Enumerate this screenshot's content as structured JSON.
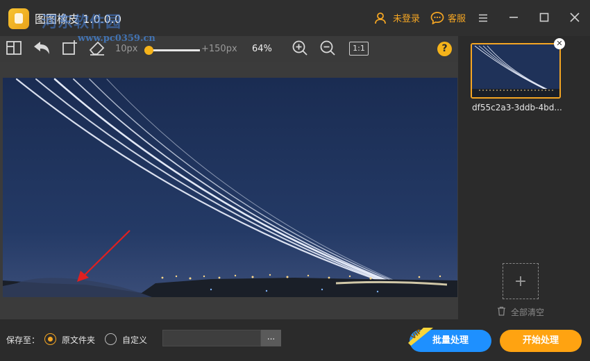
{
  "app": {
    "title": "图图橡皮 1.0.0.0",
    "watermark": "河东软件园",
    "watermark_url": "www.pc0359.cn"
  },
  "titlebar": {
    "login_label": "未登录",
    "service_label": "客服"
  },
  "toolbar": {
    "brush_min": "10px",
    "brush_max": "+150px",
    "brush_level": 0.05,
    "zoom": "64%",
    "ratio_label": "1:1",
    "help_label": "?"
  },
  "files": [
    {
      "name": "df55c2a3-3ddb-4bd..."
    }
  ],
  "side": {
    "add_label": "+",
    "clear_all": "全部清空"
  },
  "bottom": {
    "save_to": "保存至：",
    "option_original": "原文件夹",
    "option_custom": "自定义",
    "path_value": "",
    "browse": "...",
    "batch": "批量处理",
    "vip": "VIP",
    "start": "开始处理",
    "selected": "original"
  },
  "colors": {
    "accent": "#f5a623",
    "primary_blue": "#1e90ff",
    "start_orange": "#ffa311",
    "bg": "#2b2b2b"
  },
  "icons": [
    "compare-icon",
    "undo-icon",
    "crop-icon",
    "eraser-icon",
    "zoom-in-icon",
    "zoom-out-icon",
    "user-icon",
    "chat-icon",
    "menu-icon",
    "minimize-icon",
    "maximize-icon",
    "close-icon",
    "trash-icon"
  ]
}
